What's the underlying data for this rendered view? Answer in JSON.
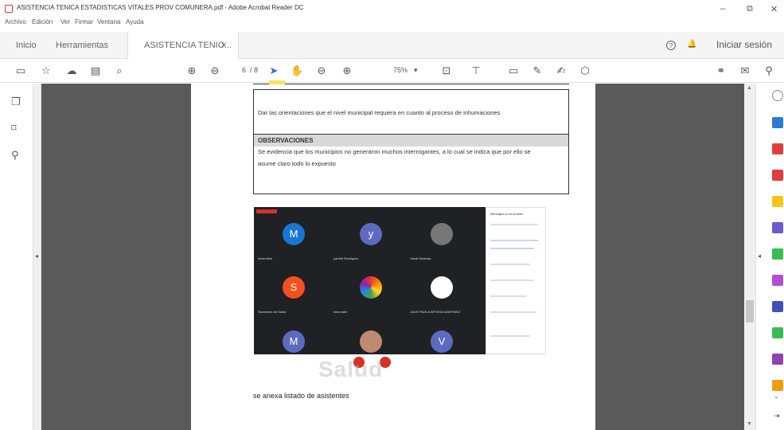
{
  "window": {
    "title": "ASISTENCIA TENICA ESTADISTICAS VITALES PROV COMUNERA.pdf - Adobe Acrobat Reader DC",
    "minimize": "–",
    "maximize": "⧉",
    "close": "✕"
  },
  "menu": [
    "Archivo",
    "Edición",
    "Ver",
    "Firmar",
    "Ventana",
    "Ayuda"
  ],
  "tabs": {
    "home": "Inicio",
    "tools": "Herramientas",
    "document": "ASISTENCIA TENIC...",
    "close": "×"
  },
  "header_right": {
    "help_icon": "?",
    "bell_icon": "🔔",
    "signin": "Iniciar sesión"
  },
  "toolbar": {
    "page_current": "6",
    "page_total": "/ 8",
    "zoom": "75%",
    "zoom_arrow": "▾"
  },
  "document": {
    "line1": "Dar las orientaciones que el nivel municipal requiera en cuanto al proceso de inhumaciones",
    "obs_heading": "OBSERVACIONES",
    "obs_text1": "Se evidencia que los municipios no generaron muchos interrogantes, a lo cual se indica que por ello se",
    "obs_text2": "asume claro todo lo expuesto",
    "annex": "se anexa listado de asistentes"
  },
  "meeting": {
    "tiles": [
      {
        "initial": "M",
        "color": "#1976d2",
        "label": "nana elkin"
      },
      {
        "initial": "y",
        "color": "#5c6bc0",
        "label": "yaneth Rodriguez"
      },
      {
        "initial": "",
        "color": "#777777",
        "label": "Yandi Vanessa"
      },
      {
        "initial": "S",
        "color": "#f4511e",
        "label": "Secretaría de Salud"
      },
      {
        "initial": "",
        "color": "#ffffff",
        "label": "silva salle"
      },
      {
        "initial": "",
        "color": "#ffffff",
        "label": "JULIE PAOLA ARTEGA MARTINEZ"
      },
      {
        "initial": "M",
        "color": "#5c6bc0",
        "label": ""
      },
      {
        "initial": "",
        "color": "#c08a70",
        "label": ""
      },
      {
        "initial": "V",
        "color": "#5c6bc0",
        "label": ""
      }
    ],
    "side_title": "Mensajes en la reunión"
  },
  "watermark": "Salud"
}
